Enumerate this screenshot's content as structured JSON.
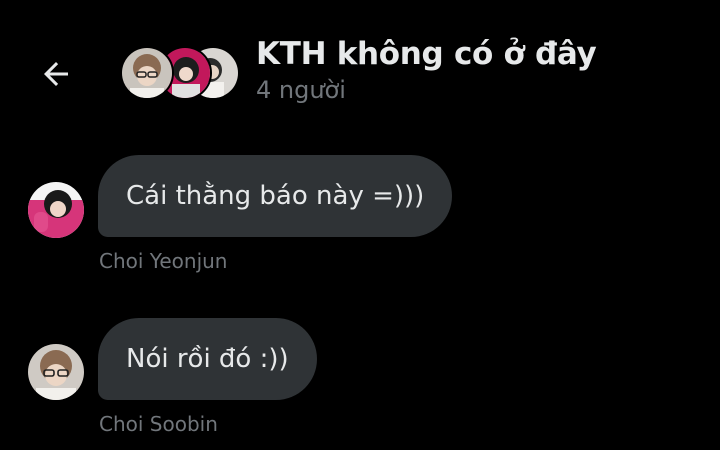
{
  "header": {
    "title": "KTH không có ở đây",
    "subtitle": "4 người",
    "back_icon": "arrow-left-icon",
    "group_avatars": [
      "avatar-1",
      "avatar-2",
      "avatar-3"
    ]
  },
  "messages": [
    {
      "text": "Cái thằng báo này =)))",
      "sender": "Choi Yeonjun",
      "avatar_color": "#d6357a"
    },
    {
      "text": "Nói rồi đó :))",
      "sender": "Choi Soobin",
      "avatar_color": "#cfcac4"
    }
  ],
  "colors": {
    "background": "#000000",
    "bubble": "#2f3336",
    "text_primary": "#e7e9ea",
    "text_secondary": "#71767b"
  }
}
